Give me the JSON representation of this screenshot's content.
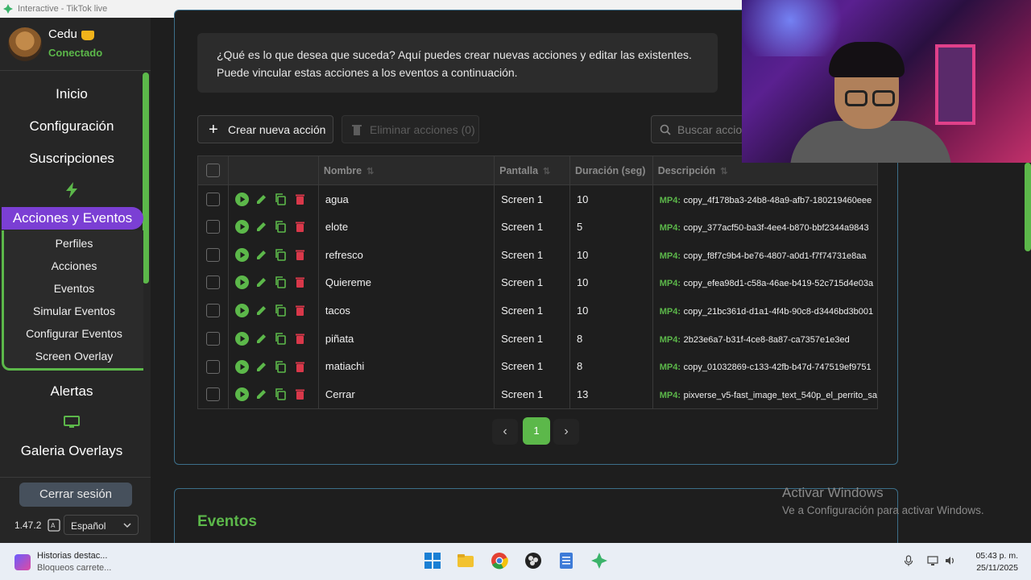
{
  "window": {
    "title": "Interactive - TikTok live"
  },
  "sidebar": {
    "user": {
      "name": "Cedu",
      "status": "Conectado"
    },
    "items": [
      {
        "label": "Inicio"
      },
      {
        "label": "Configuración"
      },
      {
        "label": "Suscripciones"
      }
    ],
    "active": "Acciones y Eventos",
    "subitems": [
      "Perfiles",
      "Acciones",
      "Eventos",
      "Simular Eventos",
      "Configurar Eventos",
      "Screen Overlay"
    ],
    "alerts": "Alertas",
    "gallery": "Galeria Overlays",
    "logout": "Cerrar sesión",
    "version": "1.47.2",
    "language": "Español",
    "accent": "#5cb84a",
    "active_color": "#7b3fd4"
  },
  "main": {
    "info_line1": "¿Qué es lo que desea que suceda? Aquí puedes crear nuevas acciones y editar las existentes.",
    "info_line2": "Puede vincular estas acciones a los eventos a continuación.",
    "create_button": "Crear nueva acción",
    "delete_button": "Eliminar acciones (0)",
    "search_placeholder": "Buscar accion",
    "columns": [
      "Nombre",
      "Pantalla",
      "Duración (seg)",
      "Descripción"
    ],
    "rows": [
      {
        "name": "agua",
        "screen": "Screen 1",
        "duration": "10",
        "type": "MP4:",
        "desc": "copy_4f178ba3-24b8-48a9-afb7-180219460eee"
      },
      {
        "name": "elote",
        "screen": "Screen 1",
        "duration": "5",
        "type": "MP4:",
        "desc": "copy_377acf50-ba3f-4ee4-b870-bbf2344a9843"
      },
      {
        "name": "refresco",
        "screen": "Screen 1",
        "duration": "10",
        "type": "MP4:",
        "desc": "copy_f8f7c9b4-be76-4807-a0d1-f7f74731e8aa"
      },
      {
        "name": "Quiereme",
        "screen": "Screen 1",
        "duration": "10",
        "type": "MP4:",
        "desc": "copy_efea98d1-c58a-46ae-b419-52c715d4e03a"
      },
      {
        "name": "tacos",
        "screen": "Screen 1",
        "duration": "10",
        "type": "MP4:",
        "desc": "copy_21bc361d-d1a1-4f4b-90c8-d3446bd3b001"
      },
      {
        "name": "piñata",
        "screen": "Screen 1",
        "duration": "8",
        "type": "MP4:",
        "desc": "2b23e6a7-b31f-4ce8-8a87-ca7357e1e3ed"
      },
      {
        "name": "matiachi",
        "screen": "Screen 1",
        "duration": "8",
        "type": "MP4:",
        "desc": "copy_01032869-c133-42fb-b47d-747519ef9751"
      },
      {
        "name": "Cerrar",
        "screen": "Screen 1",
        "duration": "13",
        "type": "MP4:",
        "desc": "pixverse_v5-fast_image_text_540p_el_perrito_sa"
      }
    ],
    "pager": {
      "prev": "‹",
      "current": "1",
      "next": "›"
    },
    "events_title": "Eventos"
  },
  "watermark": {
    "line1": "Activar Windows",
    "line2": "Ve a Configuración para activar Windows."
  },
  "taskbar": {
    "news_title": "Historias destac...",
    "news_sub": "Bloqueos carrete...",
    "time": "05:43 p. m.",
    "date": "25/11/2025"
  }
}
